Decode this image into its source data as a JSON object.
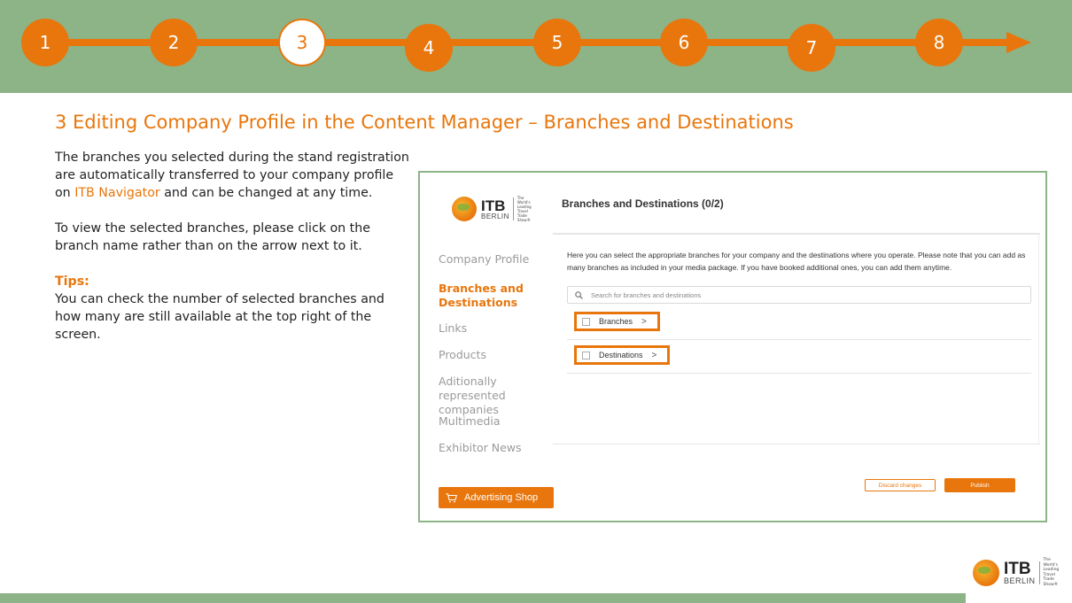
{
  "steps": [
    {
      "label": "1",
      "current": false
    },
    {
      "label": "2",
      "current": false
    },
    {
      "label": "3",
      "current": true
    },
    {
      "label": "4",
      "current": false
    },
    {
      "label": "5",
      "current": false
    },
    {
      "label": "6",
      "current": false
    },
    {
      "label": "7",
      "current": false
    },
    {
      "label": "8",
      "current": false
    }
  ],
  "title": "3 Editing Company Profile in the Content Manager – Branches and Destinations",
  "intro": {
    "p1_before": "The branches you selected during the stand registration are automatically transferred to your company profile on ",
    "p1_link": "ITB Navigator",
    "p1_after": " and can be changed at any time.",
    "p2": "To view the selected branches, please click on the branch name rather than on the arrow next to it.",
    "tips_heading": "Tips:",
    "tips_body": "You can check the number of selected branches and how many are still available at the top right of the screen."
  },
  "logo": {
    "itb": "ITB",
    "berlin": "BERLIN",
    "tagline": "The World's Leading Travel Trade Show®"
  },
  "sidebar": {
    "items": [
      {
        "label": "Company Profile",
        "active": false
      },
      {
        "label": "Branches and Destinations",
        "active": true
      },
      {
        "label": "Links",
        "active": false
      },
      {
        "label": "Products",
        "active": false
      },
      {
        "label": "Aditionally represented companies",
        "active": false
      },
      {
        "label": "Multimedia",
        "active": false
      },
      {
        "label": "Exhibitor News",
        "active": false
      }
    ],
    "shop_button": "Advertising Shop"
  },
  "main": {
    "heading": "Branches and Destinations (0/2)",
    "description": "Here you can select the appropriate branches for your company and the destinations where you operate. Please note that you can add as many branches as included in your media package. If you have booked additional ones, you can add them anytime.",
    "search_placeholder": "Search for branches and destinations",
    "rows": [
      {
        "label": "Branches",
        "chevron": ">"
      },
      {
        "label": "Destinations",
        "chevron": ">"
      }
    ],
    "discard_label": "Discard changes",
    "publish_label": "Publish"
  },
  "colors": {
    "accent": "#e8760c",
    "banner": "#8cb487"
  }
}
